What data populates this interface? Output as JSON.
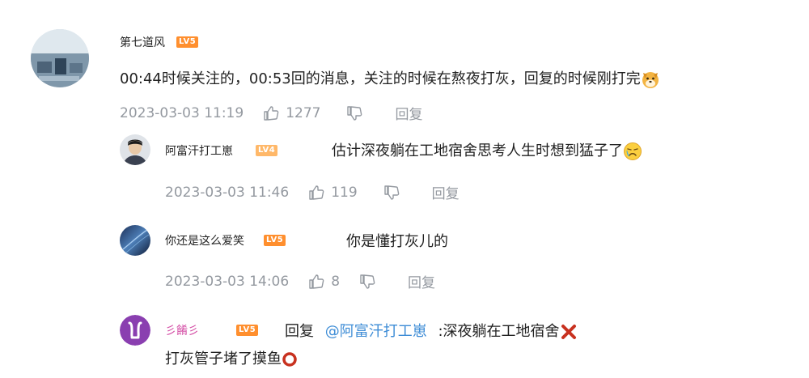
{
  "comments": [
    {
      "username": "第七道风",
      "level": "LV5",
      "text": "00:44时候关注的，00:53回的消息，关注的时候在熬夜打灰，回复的时候刚打完",
      "emoji": "dog-face-emoji",
      "time": "2023-03-03 11:19",
      "likes": "1277",
      "reply_label": "回复"
    },
    {
      "username": "阿富汗打工崽",
      "level": "LV4",
      "text": "估计深夜躺在工地宿舍思考人生时想到猛子了",
      "emoji": "crying-emoji",
      "time": "2023-03-03 11:46",
      "likes": "119",
      "reply_label": "回复"
    },
    {
      "username": "你还是这么爱笑",
      "level": "LV5",
      "text": "你是懂打灰儿的",
      "time": "2023-03-03 14:06",
      "likes": "8",
      "reply_label": "回复"
    },
    {
      "username": "彡餚彡",
      "level": "LV5",
      "reply_prefix": "回复",
      "mention": "@阿富汗打工崽",
      "text_line1": ":深夜躺在工地宿舍",
      "text_line2": "打灰管子堵了摸鱼",
      "emoji1": "cross-mark-emoji",
      "emoji2": "hollow-circle-emoji"
    }
  ],
  "colors": {
    "meta_gray": "#9499a0",
    "mention_blue": "#3d8cd6",
    "level5_orange": "#ff8f2e",
    "level4_orange": "#ffb869",
    "username_purple": "#d44ea6"
  }
}
